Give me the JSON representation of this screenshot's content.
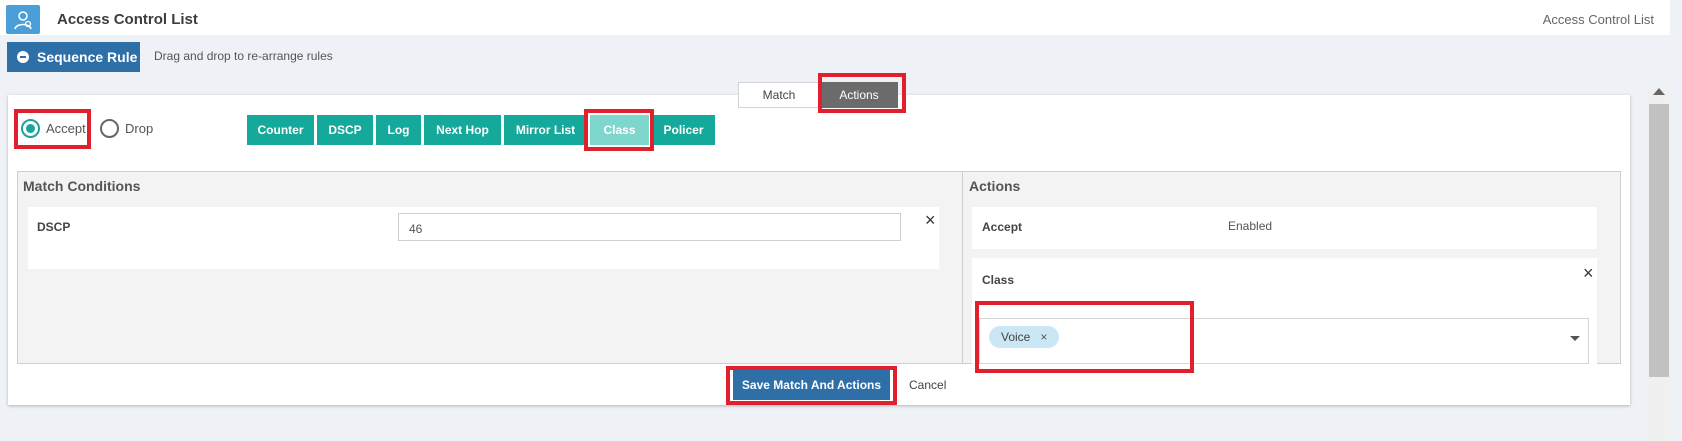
{
  "header": {
    "title": "Access Control List",
    "breadcrumb": "Access Control List"
  },
  "toolbar": {
    "sequence_rule_label": "Sequence Rule",
    "drag_hint": "Drag and drop to re-arrange rules"
  },
  "tabs": [
    {
      "label": "Match",
      "active": false
    },
    {
      "label": "Actions",
      "active": true
    }
  ],
  "radios": [
    {
      "label": "Accept",
      "checked": true
    },
    {
      "label": "Drop",
      "checked": false
    }
  ],
  "action_buttons": [
    {
      "label": "Counter",
      "active": false
    },
    {
      "label": "DSCP",
      "active": false
    },
    {
      "label": "Log",
      "active": false
    },
    {
      "label": "Next Hop",
      "active": false
    },
    {
      "label": "Mirror List",
      "active": false
    },
    {
      "label": "Class",
      "active": true
    },
    {
      "label": "Policer",
      "active": false
    }
  ],
  "match_conditions": {
    "title": "Match Conditions",
    "dscp_label": "DSCP",
    "dscp_value": "46",
    "remove_symbol": "×"
  },
  "actions_panel": {
    "title": "Actions",
    "accept_label": "Accept",
    "accept_value": "Enabled",
    "class_label": "Class",
    "remove_symbol": "×",
    "selected_class": "Voice",
    "chip_remove_symbol": "×"
  },
  "footer": {
    "save_label": "Save Match And Actions",
    "cancel_label": "Cancel"
  },
  "colors": {
    "primary_blue": "#2e6fa8",
    "teal": "#14a99a",
    "teal_active": "#7fd6cd",
    "highlight_red": "#e0202c",
    "tab_active": "#6b6b6b"
  }
}
